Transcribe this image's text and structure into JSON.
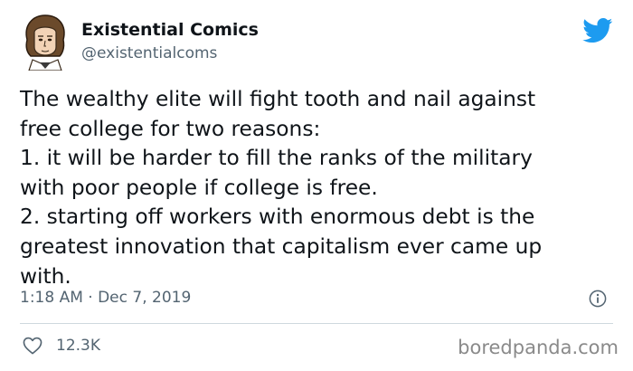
{
  "author": {
    "display_name": "Existential Comics",
    "handle": "@existentialcoms",
    "avatar_icon": "cartoon-portrait-avatar",
    "platform_icon": "twitter-bird-icon"
  },
  "tweet": {
    "lines": [
      "The wealthy elite will fight tooth and nail against",
      "free college for two reasons:",
      "1. it will be harder to fill the ranks of the military",
      "with poor people if college is free.",
      "2. starting off workers with enormous debt is the",
      "greatest innovation that capitalism ever came up",
      "with."
    ],
    "timestamp": "1:18 AM · Dec 7, 2019"
  },
  "engagement": {
    "likes": "12.3K"
  },
  "watermark": "boredpanda.com",
  "colors": {
    "text": "#0f1419",
    "secondary_text": "#536471",
    "twitter_blue": "#1d9bf0",
    "divider": "#cfd9de"
  }
}
